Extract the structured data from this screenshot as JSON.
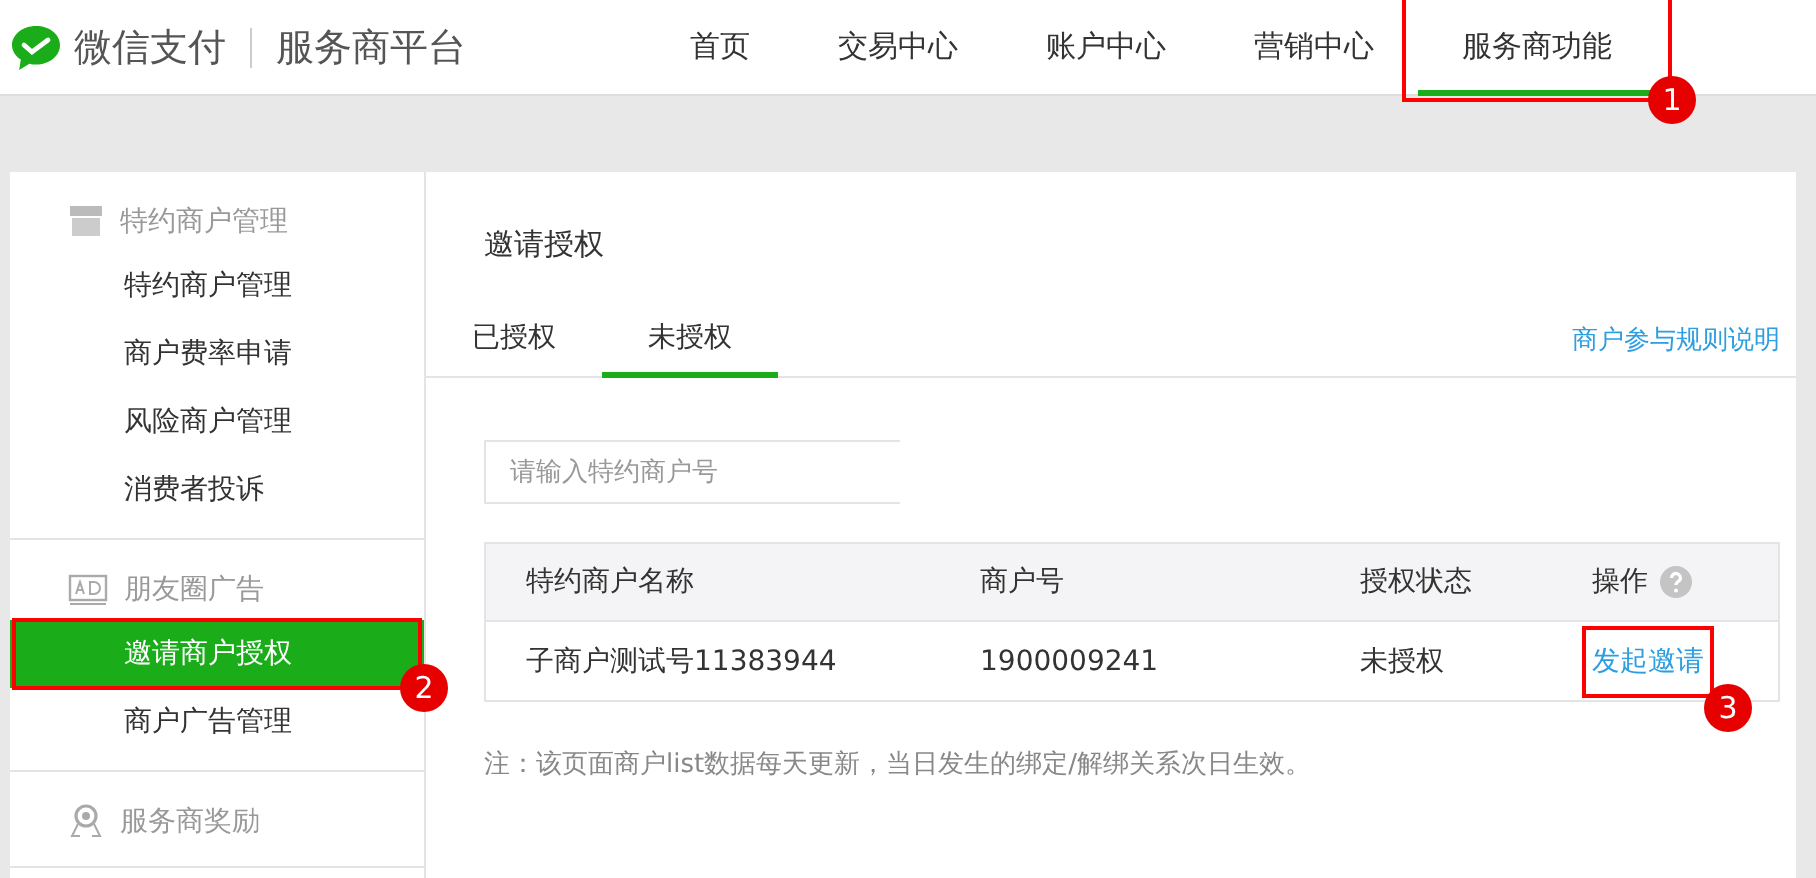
{
  "header": {
    "brand": "微信支付",
    "platform": "服务商平台"
  },
  "nav": [
    {
      "label": "首页",
      "selected": false
    },
    {
      "label": "交易中心",
      "selected": false
    },
    {
      "label": "账户中心",
      "selected": false
    },
    {
      "label": "营销中心",
      "selected": false
    },
    {
      "label": "服务商功能",
      "selected": true,
      "annotation": "1"
    }
  ],
  "sidebar": [
    {
      "title": "特约商户管理",
      "kind": "store",
      "items": [
        {
          "label": "特约商户管理",
          "selected": false
        },
        {
          "label": "商户费率申请",
          "selected": false
        },
        {
          "label": "风险商户管理",
          "selected": false
        },
        {
          "label": "消费者投诉",
          "selected": false
        }
      ]
    },
    {
      "title": "朋友圈广告",
      "kind": "ad",
      "items": [
        {
          "label": "邀请商户授权",
          "selected": true,
          "annotation": "2"
        },
        {
          "label": "商户广告管理",
          "selected": false
        }
      ]
    },
    {
      "title": "服务商奖励",
      "kind": "award"
    }
  ],
  "main": {
    "title": "邀请授权",
    "tabs": [
      {
        "label": "已授权",
        "selected": false
      },
      {
        "label": "未授权",
        "selected": true
      }
    ],
    "rules_link": "商户参与规则说明",
    "search": {
      "placeholder": "请输入特约商户号"
    },
    "table": {
      "columns": [
        "特约商户名称",
        "商户号",
        "授权状态",
        "操作"
      ],
      "rows": [
        {
          "name": "子商户测试号11383944",
          "merchant_id": "1900009241",
          "status": "未授权",
          "action": "发起邀请",
          "annotation": "3"
        }
      ]
    },
    "note": "注：该页面商户list数据每天更新，当日发生的绑定/解绑关系次日生效。"
  }
}
